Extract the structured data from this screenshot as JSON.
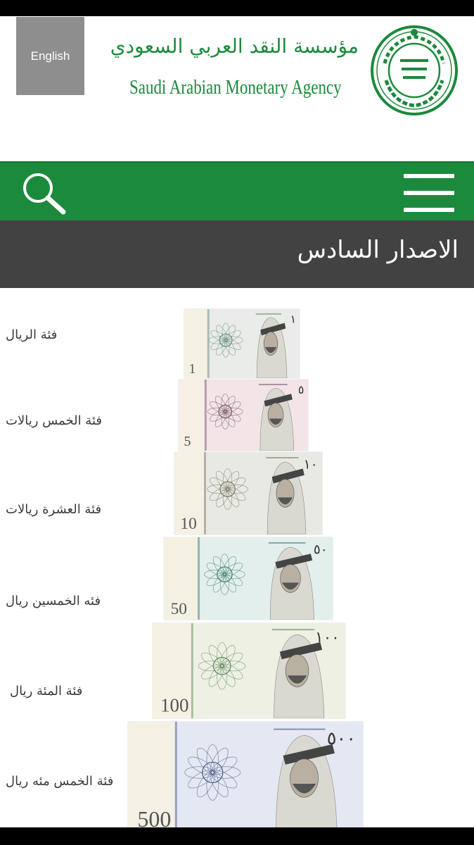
{
  "header": {
    "language_button": "English",
    "brand_arabic": "مؤسسة النقد العربي السعودي",
    "brand_english": "Saudi Arabian Monetary Agency",
    "seal_icon": "sama-seal-icon"
  },
  "nav": {
    "search_icon": "search-icon",
    "menu_icon": "hamburger-menu-icon",
    "bar_color": "#1b8a3c"
  },
  "section": {
    "title": "الاصدار السادس"
  },
  "denominations": [
    {
      "label": "فئة الريال",
      "numeral": "1",
      "arabic_numeral": "١",
      "tint": "#e9ece8",
      "accent": "#6d8f7d"
    },
    {
      "label": "فئة الخمس ريالات",
      "numeral": "5",
      "arabic_numeral": "٥",
      "tint": "#f3e4e8",
      "accent": "#7a5a6a"
    },
    {
      "label": "فئة العشرة ريالات",
      "numeral": "10",
      "arabic_numeral": "١٠",
      "tint": "#e9e9e4",
      "accent": "#7b7a66"
    },
    {
      "label": "فئه الخمسين ريال",
      "numeral": "50",
      "arabic_numeral": "٥٠",
      "tint": "#e3efec",
      "accent": "#3f7f73"
    },
    {
      "label": "فئة المئة ريال",
      "numeral": "100",
      "arabic_numeral": "١٠٠",
      "tint": "#eef0e4",
      "accent": "#5f8a5a"
    },
    {
      "label": "فئة الخمس مئه ريال",
      "numeral": "500",
      "arabic_numeral": "٥٠٠",
      "tint": "#e4e8f2",
      "accent": "#4a5a8a"
    }
  ]
}
